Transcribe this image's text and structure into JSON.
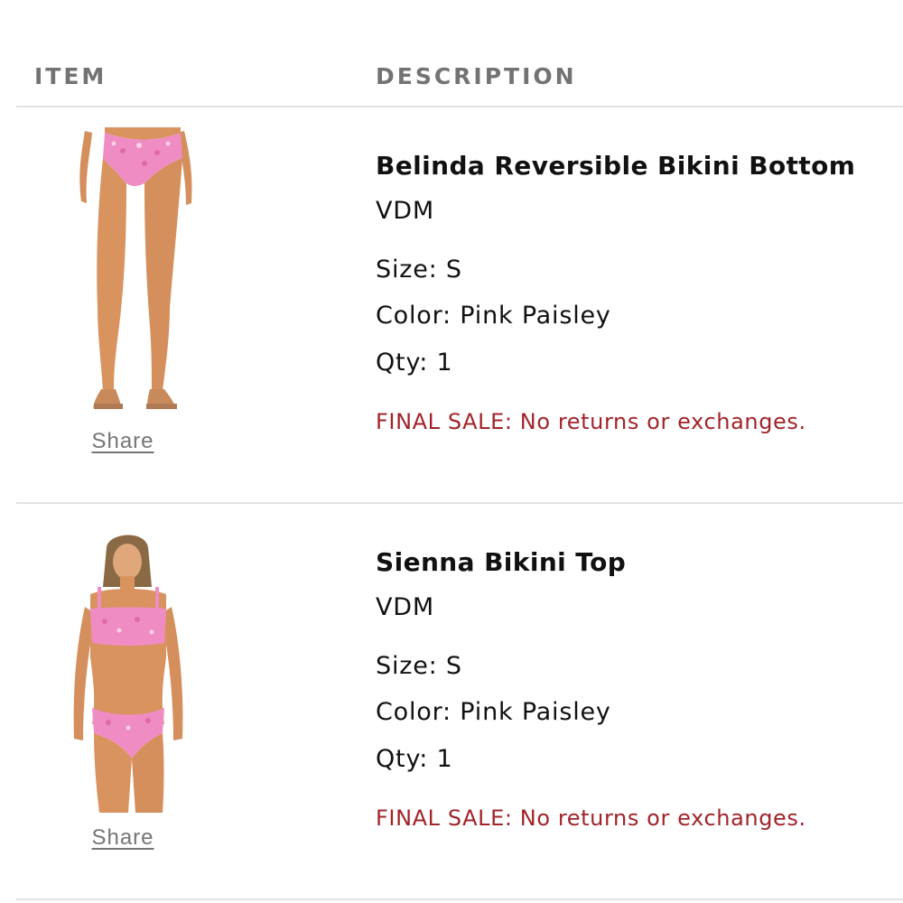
{
  "header": {
    "item_label": "ITEM",
    "description_label": "DESCRIPTION"
  },
  "items": [
    {
      "name": "Belinda Reversible Bikini Bottom",
      "brand": "VDM",
      "size": "Size: S",
      "color": "Color: Pink Paisley",
      "qty": "Qty: 1",
      "notice": "FINAL SALE: No returns or exchanges.",
      "share_label": "Share",
      "image": "model-wearing-pink-paisley-bikini-bottom"
    },
    {
      "name": "Sienna Bikini Top",
      "brand": "VDM",
      "size": "Size: S",
      "color": "Color: Pink Paisley",
      "qty": "Qty: 1",
      "notice": "FINAL SALE: No returns or exchanges.",
      "share_label": "Share",
      "image": "model-wearing-pink-paisley-bikini-set"
    }
  ],
  "colors": {
    "header_text": "#737373",
    "divider": "#e2e2e2",
    "notice": "#a1242a",
    "link": "#757575",
    "swimwear": "#f08cc4",
    "skin": "#d9935f"
  }
}
